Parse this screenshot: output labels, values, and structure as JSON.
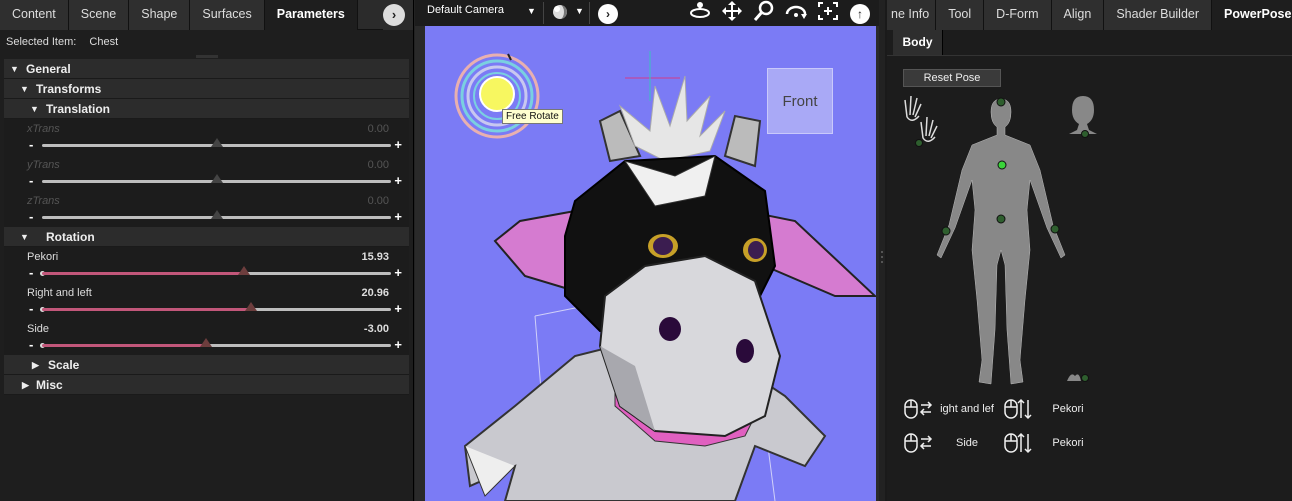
{
  "left_panel": {
    "tabs": [
      "Content",
      "Scene",
      "Shape",
      "Surfaces",
      "Parameters"
    ],
    "active_tab": "Parameters",
    "selected_item_label": "Selected Item:",
    "selected_item_value": "Chest",
    "tree": {
      "general": "General",
      "transforms": "Transforms",
      "translation": "Translation",
      "rotation": "Rotation",
      "scale": "Scale",
      "misc": "Misc"
    },
    "translation_params": [
      {
        "name": "xTrans",
        "value": "0.00",
        "fraction": 0.5
      },
      {
        "name": "yTrans",
        "value": "0.00",
        "fraction": 0.5
      },
      {
        "name": "zTrans",
        "value": "0.00",
        "fraction": 0.5
      }
    ],
    "rotation_params": [
      {
        "name": "Pekori",
        "value": "15.93",
        "fraction": 0.58
      },
      {
        "name": "Right and left",
        "value": "20.96",
        "fraction": 0.6
      },
      {
        "name": "Side",
        "value": "-3.00",
        "fraction": 0.47
      }
    ]
  },
  "viewport": {
    "camera": "Default Camera",
    "cube_label": "Front",
    "tooltip": "Free Rotate",
    "background_color": "#7b7bf5"
  },
  "right_panel": {
    "tabs": [
      "ne Info",
      "Tool",
      "D-Form",
      "Align",
      "Shader Builder",
      "PowerPose"
    ],
    "active_tab": "PowerPose",
    "subtab": "Body",
    "reset_pose": "Reset Pose",
    "controls": {
      "lr_drag_label": "ight and lef",
      "ud_drag_label": "Pekori",
      "lr_drag2_label": "Side",
      "ud_drag2_label": "Pekori"
    }
  }
}
